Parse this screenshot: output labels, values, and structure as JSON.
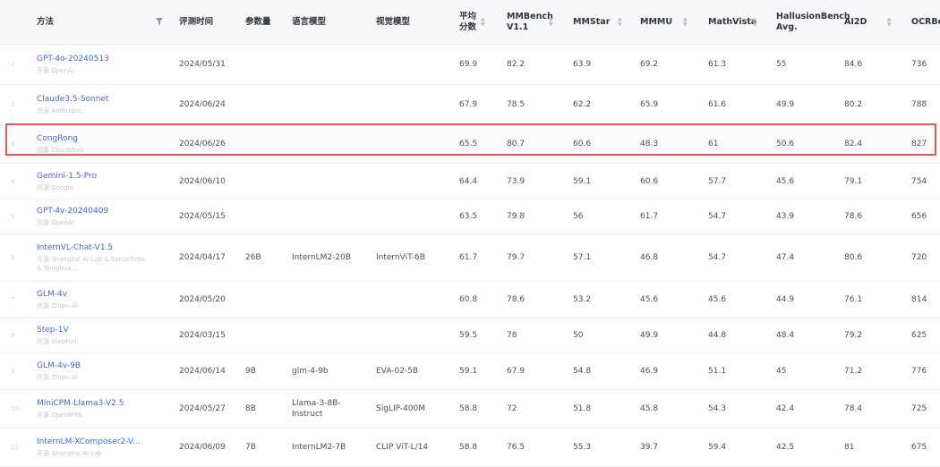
{
  "table": {
    "headers": {
      "method": "方法",
      "eval_time": "评测时间",
      "params": "参数量",
      "lang_model": "语言模型",
      "vision_model": "视觉模型",
      "avg_line1": "平均",
      "avg_line2": "分数",
      "mmbench_line1": "MMBench",
      "mmbench_line2": "V1.1",
      "mmstar": "MMStar",
      "mmmu": "MMMU",
      "mathvista": "MathVista",
      "hallusion_line1": "HallusionBench",
      "hallusion_line2": "Avg.",
      "ai2d": "AI2D",
      "ocrbench": "OCRBen"
    },
    "rows": [
      {
        "idx": "1",
        "name": "GPT-4o-20240513",
        "org": "开源 OpenAI",
        "date": "2024/05/31",
        "params": "",
        "lang": "",
        "vision": "",
        "avg": "69.9",
        "mmbench": "82.2",
        "mmstar": "63.9",
        "mmmu": "69.2",
        "mathvista": "61.3",
        "hallusion": "55",
        "ai2d": "84.6",
        "ocr": "736"
      },
      {
        "idx": "2",
        "name": "Claude3.5-Sonnet",
        "org": "闭源 Anthropic",
        "date": "2024/06/24",
        "params": "",
        "lang": "",
        "vision": "",
        "avg": "67.9",
        "mmbench": "78.5",
        "mmstar": "62.2",
        "mmmu": "65.9",
        "mathvista": "61.6",
        "hallusion": "49.9",
        "ai2d": "80.2",
        "ocr": "788"
      },
      {
        "idx": "3",
        "name": "CongRong",
        "org": "闭源 CloudWalk",
        "date": "2024/06/26",
        "params": "",
        "lang": "",
        "vision": "",
        "avg": "65.5",
        "mmbench": "80.7",
        "mmstar": "60.6",
        "mmmu": "48.3",
        "mathvista": "61",
        "hallusion": "50.6",
        "ai2d": "82.4",
        "ocr": "827"
      },
      {
        "idx": "4",
        "name": "Gemini-1.5-Pro",
        "org": "闭源 Google",
        "date": "2024/06/10",
        "params": "",
        "lang": "",
        "vision": "",
        "avg": "64.4",
        "mmbench": "73.9",
        "mmstar": "59.1",
        "mmmu": "60.6",
        "mathvista": "57.7",
        "hallusion": "45.6",
        "ai2d": "79.1",
        "ocr": "754"
      },
      {
        "idx": "5",
        "name": "GPT-4v-20240409",
        "org": "闭源 OpenAI",
        "date": "2024/05/15",
        "params": "",
        "lang": "",
        "vision": "",
        "avg": "63.5",
        "mmbench": "79.8",
        "mmstar": "56",
        "mmmu": "61.7",
        "mathvista": "54.7",
        "hallusion": "43.9",
        "ai2d": "78.6",
        "ocr": "656"
      },
      {
        "idx": "6",
        "name": "InternVL-Chat-V1.5",
        "org": "开源 Shanghai AI Lab & SenseTime & Tsinghua...",
        "date": "2024/04/17",
        "params": "26B",
        "lang": "InternLM2-20B",
        "vision": "InternViT-6B",
        "avg": "61.7",
        "mmbench": "79.7",
        "mmstar": "57.1",
        "mmmu": "46.8",
        "mathvista": "54.7",
        "hallusion": "47.4",
        "ai2d": "80.6",
        "ocr": "720"
      },
      {
        "idx": "7",
        "name": "GLM-4v",
        "org": "闭源 Zhipu AI",
        "date": "2024/05/20",
        "params": "",
        "lang": "",
        "vision": "",
        "avg": "60.8",
        "mmbench": "78.6",
        "mmstar": "53.2",
        "mmmu": "45.6",
        "mathvista": "45.6",
        "hallusion": "44.9",
        "ai2d": "76.1",
        "ocr": "814"
      },
      {
        "idx": "8",
        "name": "Step-1V",
        "org": "闭源 StepFun",
        "date": "2024/03/15",
        "params": "",
        "lang": "",
        "vision": "",
        "avg": "59.5",
        "mmbench": "78",
        "mmstar": "50",
        "mmmu": "49.9",
        "mathvista": "44.8",
        "hallusion": "48.4",
        "ai2d": "79.2",
        "ocr": "625"
      },
      {
        "idx": "9",
        "name": "GLM-4v-9B",
        "org": "开源 Zhipu AI",
        "date": "2024/06/14",
        "params": "9B",
        "lang": "glm-4-9b",
        "vision": "EVA-02-5B",
        "avg": "59.1",
        "mmbench": "67.9",
        "mmstar": "54.8",
        "mmmu": "46.9",
        "mathvista": "51.1",
        "hallusion": "45",
        "ai2d": "71.2",
        "ocr": "776"
      },
      {
        "idx": "10",
        "name": "MiniCPM-Llama3-V2.5",
        "org": "开源 OpenBMB",
        "date": "2024/05/27",
        "params": "8B",
        "lang": "Llama-3-8B-Instruct",
        "vision": "SigLIP-400M",
        "avg": "58.8",
        "mmbench": "72",
        "mmstar": "51.8",
        "mmmu": "45.8",
        "mathvista": "54.3",
        "hallusion": "42.4",
        "ai2d": "78.4",
        "ocr": "725"
      },
      {
        "idx": "11",
        "name": "InternLM-XComposer2-V...",
        "org": "开源 Shanghai AI Lab",
        "date": "2024/06/09",
        "params": "7B",
        "lang": "InternLM2-7B",
        "vision": "CLIP ViT-L/14",
        "avg": "58.8",
        "mmbench": "76.5",
        "mmstar": "55.3",
        "mmmu": "39.7",
        "mathvista": "59.4",
        "hallusion": "42.5",
        "ai2d": "81",
        "ocr": "675"
      }
    ]
  },
  "colors": {
    "link": "#3d6bd9",
    "highlight_border": "#e05a52",
    "header_bg": "#f7f8fa"
  },
  "icons": {
    "filter": "filter-icon",
    "sort": "sort-icon"
  }
}
